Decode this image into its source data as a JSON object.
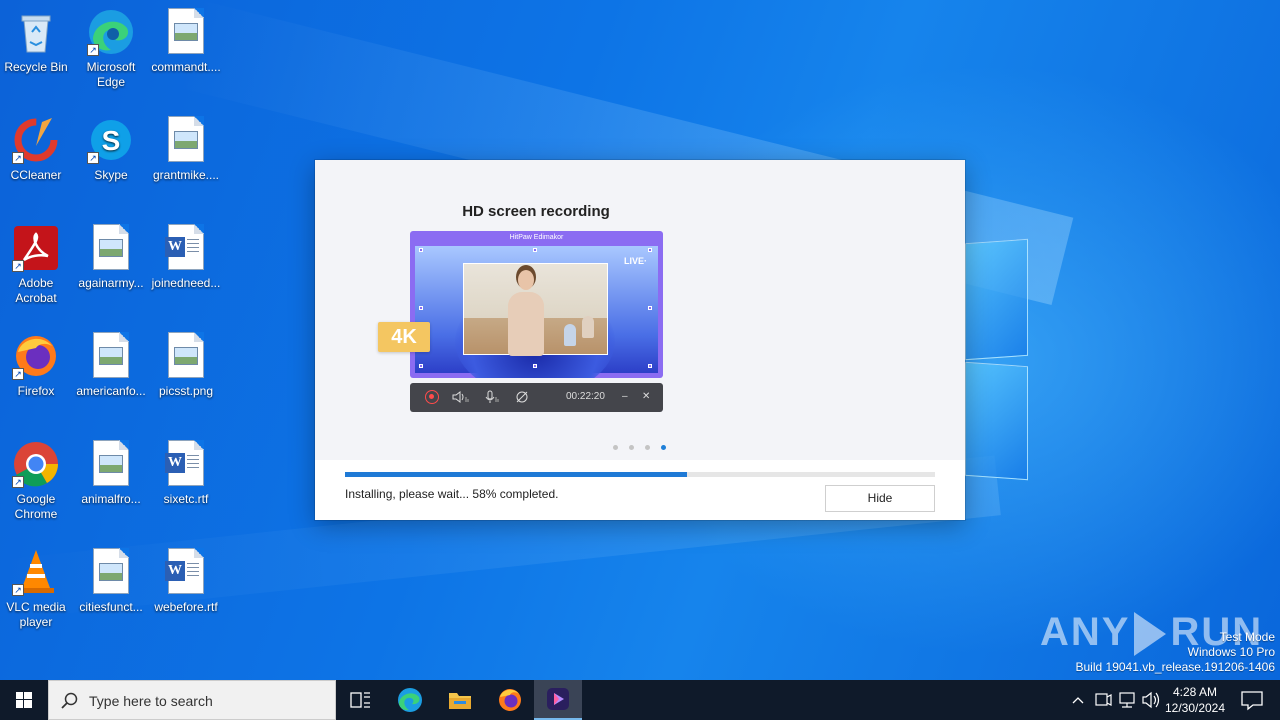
{
  "desktop": {
    "icons": [
      {
        "label": "Recycle Bin"
      },
      {
        "label": "Microsoft Edge"
      },
      {
        "label": "commandt...."
      },
      {
        "label": "CCleaner"
      },
      {
        "label": "Skype"
      },
      {
        "label": "grantmike...."
      },
      {
        "label": "Adobe Acrobat"
      },
      {
        "label": "againarmy..."
      },
      {
        "label": "joinedneed..."
      },
      {
        "label": "Firefox"
      },
      {
        "label": "americanfo..."
      },
      {
        "label": "picsst.png"
      },
      {
        "label": "Google Chrome"
      },
      {
        "label": "animalfro..."
      },
      {
        "label": "sixetc.rtf"
      },
      {
        "label": "VLC media player"
      },
      {
        "label": "citiesfunct..."
      },
      {
        "label": "webefore.rtf"
      }
    ]
  },
  "installer": {
    "slide_title": "HD screen recording",
    "mock_app_title": "HitPaw Edimakor",
    "live_label": "LIVE·",
    "badge_4k": "4K",
    "record_time": "00:22:20",
    "pager_count": 4,
    "pager_active_index": 3,
    "progress_percent": 58,
    "status_text": "Installing, please wait... 58% completed.",
    "hide_label": "Hide",
    "accent_color": "#1f7ad6"
  },
  "watermark": {
    "brand_left": "ANY",
    "brand_right": "RUN",
    "line1": "Test Mode",
    "line2": "Windows 10 Pro",
    "line3": "Build 19041.vb_release.191206-1406"
  },
  "taskbar": {
    "search_placeholder": "Type here to search",
    "apps": [
      {
        "name": "task-view-icon"
      },
      {
        "name": "edge-icon"
      },
      {
        "name": "file-explorer-icon"
      },
      {
        "name": "firefox-icon"
      },
      {
        "name": "hitpaw-icon"
      }
    ],
    "time": "4:28 AM",
    "date": "12/30/2024"
  }
}
